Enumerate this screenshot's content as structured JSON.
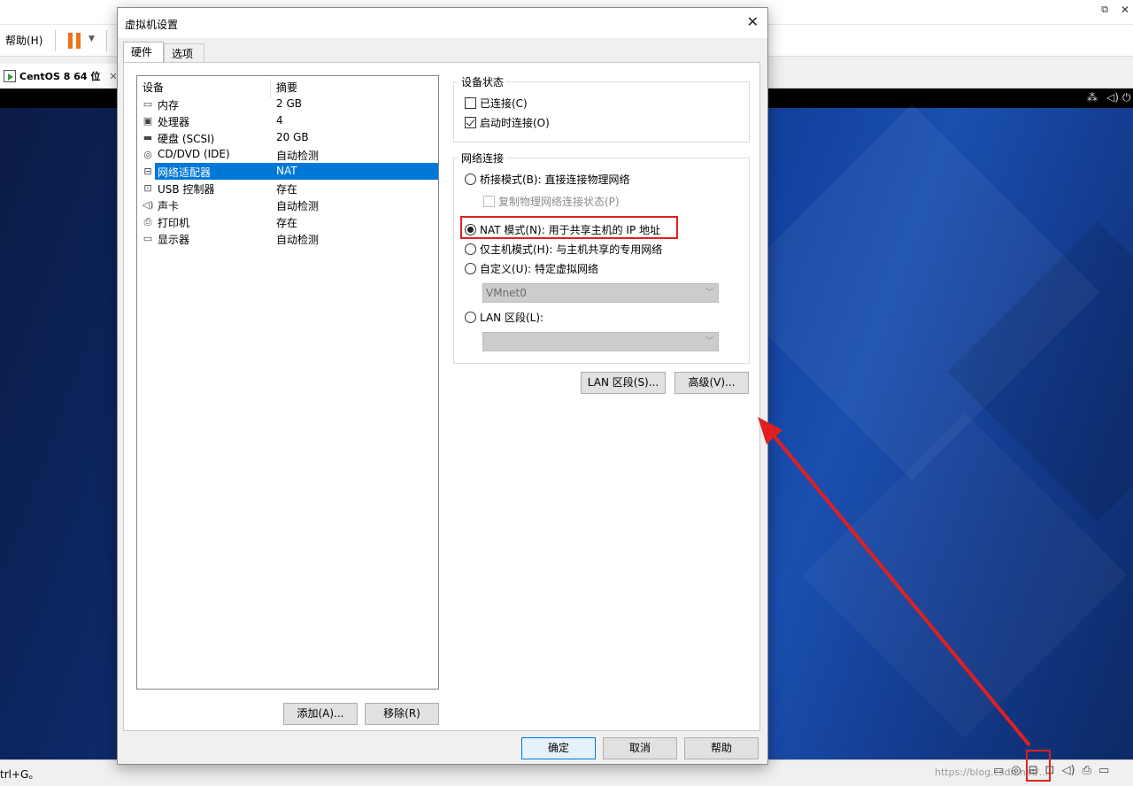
{
  "background": {
    "menu_help": "帮助(H)",
    "vm_tab_label": "CentOS 8 64 位",
    "vm_tab_close": "✕",
    "window_restore_icon": "⧉",
    "window_close_icon": "✕",
    "status_hint": "trl+G。",
    "watermark": "https://blog.csdn.net/..."
  },
  "dialog": {
    "title": "虚拟机设置",
    "close_glyph": "✕",
    "tabs": [
      {
        "label": "硬件",
        "active": true
      },
      {
        "label": "选项",
        "active": false
      }
    ],
    "device_list": {
      "col_device": "设备",
      "col_summary": "摘要",
      "items": [
        {
          "icon": "memory-icon",
          "glyph": "▭",
          "name": "内存",
          "summary": "2 GB",
          "selected": false
        },
        {
          "icon": "cpu-icon",
          "glyph": "▣",
          "name": "处理器",
          "summary": "4",
          "selected": false
        },
        {
          "icon": "hard-disk-icon",
          "glyph": "▬",
          "name": "硬盘 (SCSI)",
          "summary": "20 GB",
          "selected": false
        },
        {
          "icon": "cd-dvd-icon",
          "glyph": "◎",
          "name": "CD/DVD (IDE)",
          "summary": "自动检测",
          "selected": false
        },
        {
          "icon": "network-adapter-icon",
          "glyph": "⊟",
          "name": "网络适配器",
          "summary": "NAT",
          "selected": true
        },
        {
          "icon": "usb-icon",
          "glyph": "⊡",
          "name": "USB 控制器",
          "summary": "存在",
          "selected": false
        },
        {
          "icon": "sound-card-icon",
          "glyph": "◁)",
          "name": "声卡",
          "summary": "自动检测",
          "selected": false
        },
        {
          "icon": "printer-icon",
          "glyph": "⎙",
          "name": "打印机",
          "summary": "存在",
          "selected": false
        },
        {
          "icon": "display-icon",
          "glyph": "▭",
          "name": "显示器",
          "summary": "自动检测",
          "selected": false
        }
      ]
    },
    "add_button": "添加(A)...",
    "remove_button": "移除(R)",
    "device_status": {
      "title": "设备状态",
      "connected_label": "已连接(C)",
      "connected_checked": false,
      "connect_on_power_label": "启动时连接(O)",
      "connect_on_power_checked": true
    },
    "network": {
      "title": "网络连接",
      "bridged": "桥接模式(B): 直接连接物理网络",
      "replicate": "复制物理网络连接状态(P)",
      "nat": "NAT 模式(N): 用于共享主机的 IP 地址",
      "host_only": "仅主机模式(H): 与主机共享的专用网络",
      "custom": "自定义(U): 特定虚拟网络",
      "custom_value": "VMnet0",
      "lan": "LAN 区段(L):",
      "lan_value": "",
      "selected": "nat"
    },
    "lan_segments_button": "LAN 区段(S)...",
    "advanced_button": "高级(V)...",
    "ok_button": "确定",
    "cancel_button": "取消",
    "help_button": "帮助"
  },
  "colors": {
    "selection": "#0078d7",
    "annotation": "#e02020",
    "pause_icon": "#f07018"
  }
}
